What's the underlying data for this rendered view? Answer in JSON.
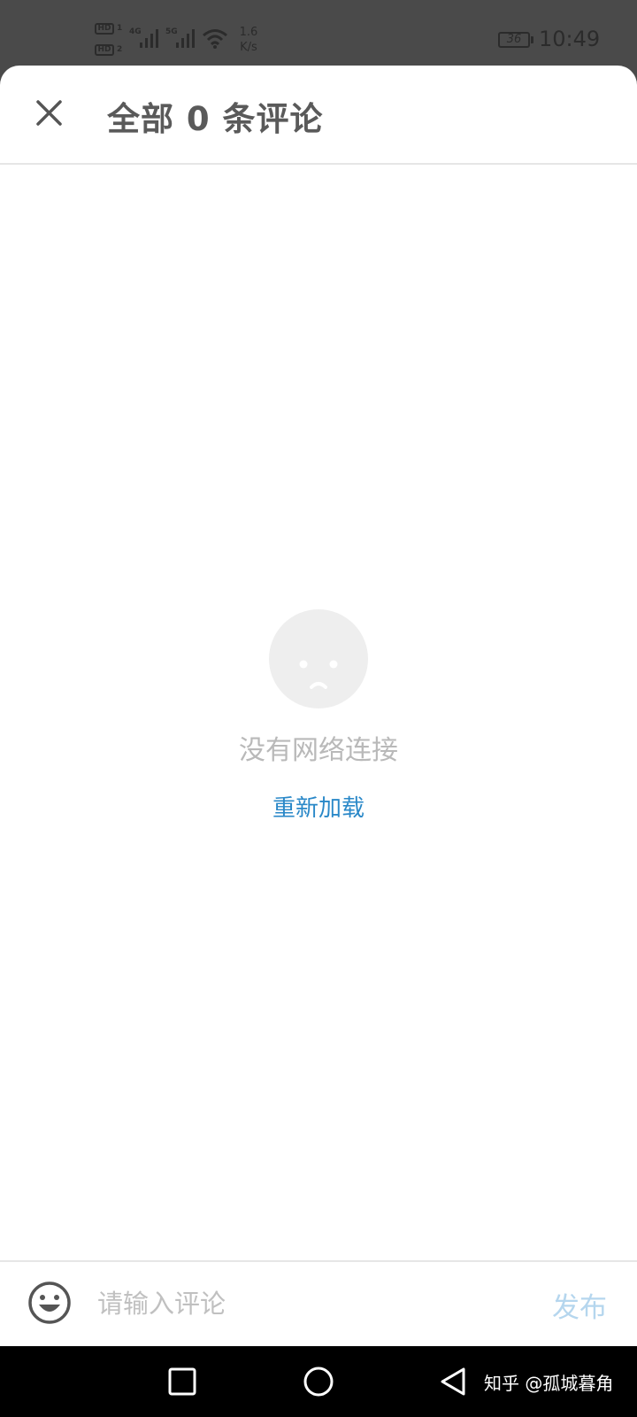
{
  "status_bar": {
    "hd_label": "HD",
    "sim1": "1",
    "sim2": "2",
    "network1": "4G",
    "network2": "5G",
    "speed_value": "1.6",
    "speed_unit": "K/s",
    "battery": "36",
    "time": "10:49"
  },
  "header": {
    "title": "全部 0 条评论",
    "close_icon": "close-icon"
  },
  "empty_state": {
    "icon": "sad-face-icon",
    "message": "没有网络连接",
    "reload_label": "重新加载"
  },
  "input_bar": {
    "emoji_icon": "smiley-icon",
    "placeholder": "请输入评论",
    "value": "",
    "publish_label": "发布"
  },
  "nav_bar": {
    "recents_icon": "square-icon",
    "home_icon": "circle-icon",
    "back_icon": "triangle-back-icon",
    "watermark": "知乎 @孤城暮角"
  },
  "colors": {
    "accent": "#2a88c8",
    "publish_disabled": "#b5d6ee",
    "muted_text": "#b9b9b9",
    "title_text": "#5a5a5a"
  }
}
